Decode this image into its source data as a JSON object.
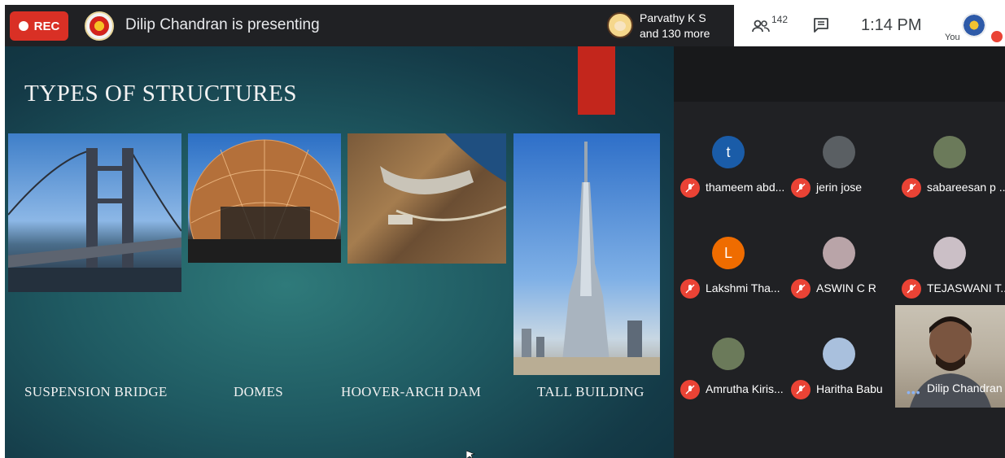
{
  "topbar": {
    "rec_label": "REC",
    "presenting_text": "Dilip Chandran is presenting",
    "viewers_line1": "Parvathy K S",
    "viewers_line2": "and 130 more",
    "people_count": "142",
    "clock": "1:14 PM",
    "you_label": "You"
  },
  "slide": {
    "title": "TYPES OF STRUCTURES",
    "captions": [
      "SUSPENSION BRIDGE",
      "DOMES",
      "HOOVER-ARCH DAM",
      "TALL BUILDING"
    ]
  },
  "participants": [
    {
      "name": "thameem abd...",
      "initial": "t",
      "avatar_color": "#1a5ca8"
    },
    {
      "name": "jerin jose",
      "initial": "",
      "avatar_color": "#5a5f63"
    },
    {
      "name": "sabareesan p ...",
      "initial": "",
      "avatar_color": "#6b7a5a"
    },
    {
      "name": "Lakshmi Tha...",
      "initial": "L",
      "avatar_color": "#ef6c00"
    },
    {
      "name": "ASWIN C R",
      "initial": "",
      "avatar_color": "#b9a4a8"
    },
    {
      "name": "TEJASWANI T...",
      "initial": "",
      "avatar_color": "#cbbfc6"
    },
    {
      "name": "Amrutha Kiris...",
      "initial": "",
      "avatar_color": "#6b7a5a"
    },
    {
      "name": "Haritha Babu",
      "initial": "",
      "avatar_color": "#a9c0dd"
    }
  ],
  "video_participant": {
    "name": "Dilip Chandran"
  },
  "colors": {
    "rec": "#d93025",
    "muted": "#ea4335",
    "accent_red": "#c3261c"
  }
}
